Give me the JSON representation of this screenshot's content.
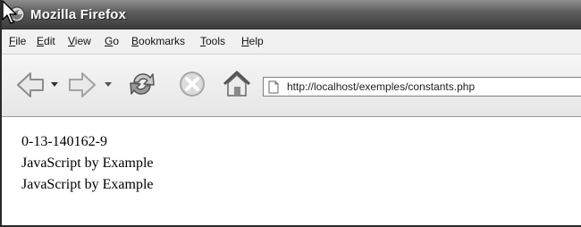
{
  "window": {
    "title": "Mozilla Firefox"
  },
  "menubar": {
    "items": [
      {
        "key": "F",
        "rest": "ile"
      },
      {
        "key": "E",
        "rest": "dit"
      },
      {
        "key": "V",
        "rest": "iew"
      },
      {
        "key": "G",
        "rest": "o"
      },
      {
        "key": "B",
        "rest": "ookmarks"
      },
      {
        "key": "T",
        "rest": "ools"
      },
      {
        "key": "H",
        "rest": "elp"
      }
    ]
  },
  "toolbar": {
    "icons": [
      "back-icon",
      "forward-icon",
      "reload-icon",
      "stop-icon",
      "home-icon",
      "page-icon"
    ],
    "url": "http://localhost/exemples/constants.php"
  },
  "page": {
    "lines": [
      "0-13-140162-9",
      "JavaScript by Example",
      "JavaScript by Example"
    ]
  },
  "colors": {
    "titlebar": "#4a4a4a",
    "title_text": "#ffffff",
    "toolbar": "#ececec"
  }
}
